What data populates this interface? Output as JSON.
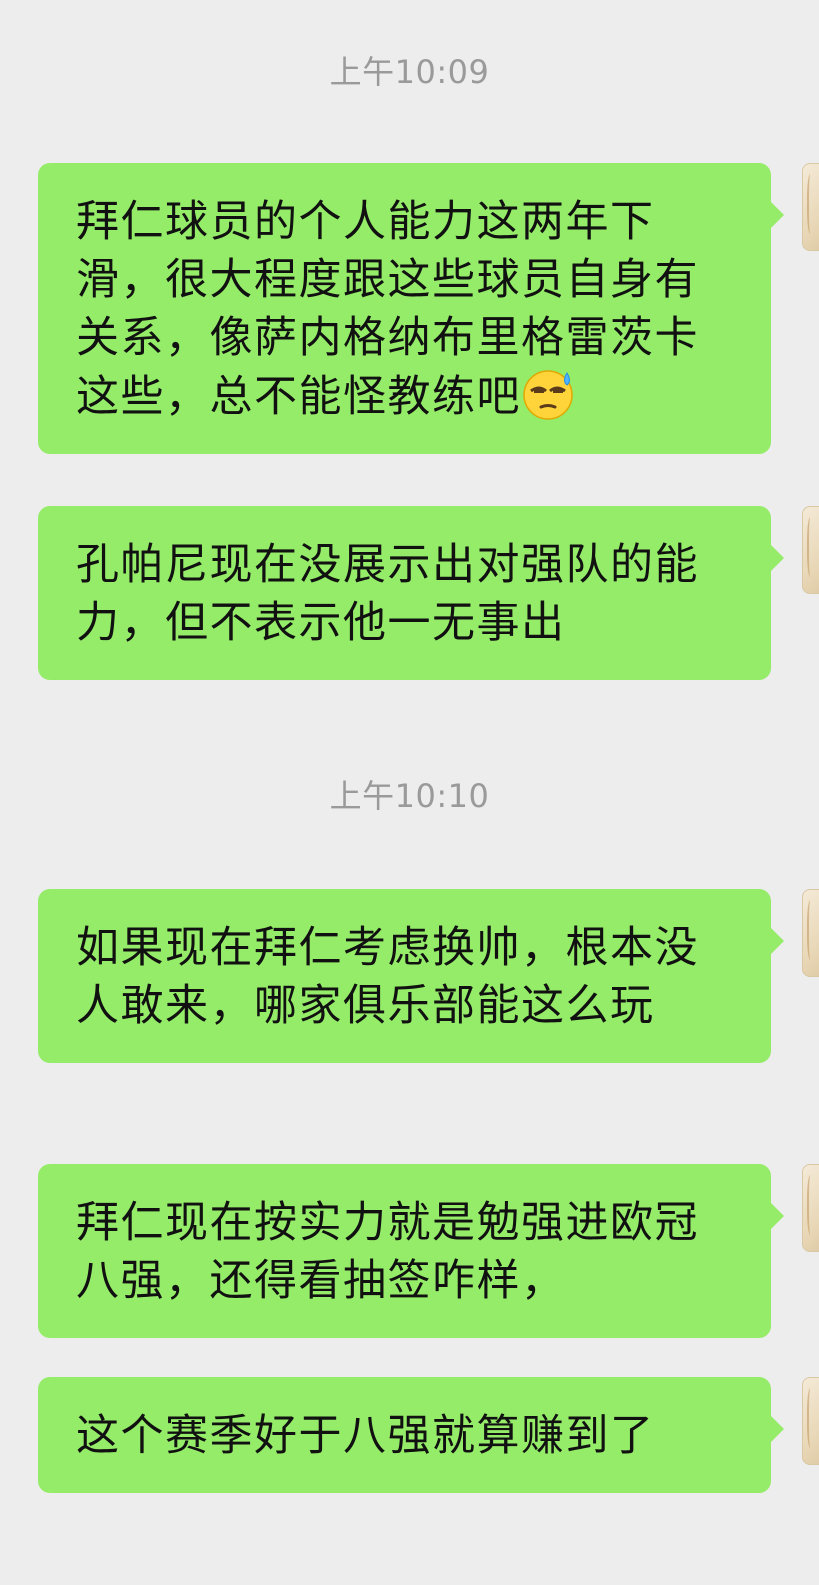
{
  "chat": {
    "timestamps": [
      "上午10:09",
      "上午10:10"
    ],
    "messages": [
      {
        "text": "拜仁球员的个人能力这两年下滑，很大程度跟这些球员自身有关系，像萨内格纳布里格雷茨卡这些，总不能怪教练吧",
        "emoji": "cold-sweat-emoji"
      },
      {
        "text": "孔帕尼现在没展示出对强队的能力，但不表示他一无事出"
      },
      {
        "text": "如果现在拜仁考虑换帅，根本没人敢来，哪家俱乐部能这么玩"
      },
      {
        "text": "拜仁现在按实力就是勉强进欧冠八强，还得看抽签咋样，"
      },
      {
        "text": "这个赛季好于八强就算赚到了"
      }
    ]
  },
  "colors": {
    "background": "#ededed",
    "bubble": "#95ec69",
    "timestamp_text": "#9a9a9a",
    "message_text": "#111111"
  },
  "icons": {
    "avatar": "user-avatar-image"
  }
}
